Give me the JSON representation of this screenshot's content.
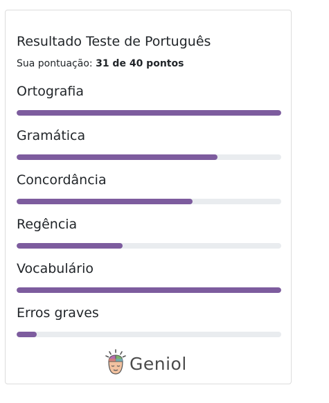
{
  "result": {
    "title": "Resultado Teste de Português",
    "score_prefix": "Sua pontuação: ",
    "score_value": "31 de 40 pontos"
  },
  "categories": [
    {
      "label": "Ortografia",
      "fraction": 1.0
    },
    {
      "label": "Gramática",
      "fraction": 0.76
    },
    {
      "label": "Concordância",
      "fraction": 0.665
    },
    {
      "label": "Regência",
      "fraction": 0.4
    },
    {
      "label": "Vocabulário",
      "fraction": 1.0
    },
    {
      "label": "Erros graves",
      "fraction": 0.075
    }
  ],
  "colors": {
    "bar_fill": "#7d5c9e",
    "bar_track": "#e9ecef"
  },
  "brand": {
    "logo_text": "Geniol",
    "logo_icon": "head-brain-icon"
  }
}
